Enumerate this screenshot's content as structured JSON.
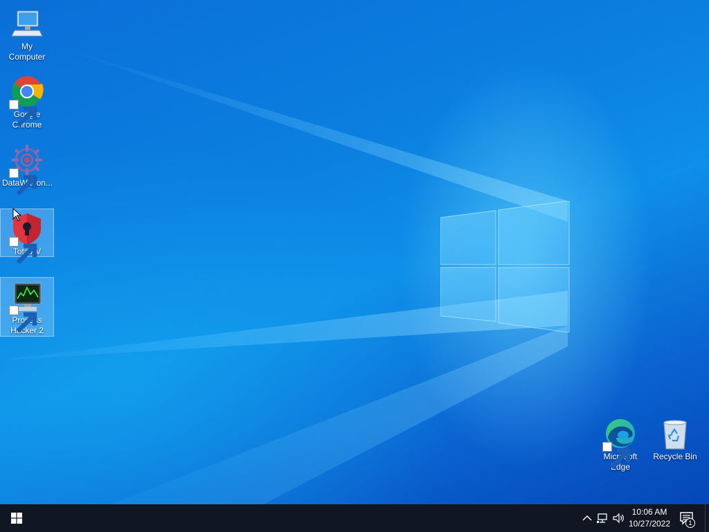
{
  "desktop": {
    "icons": [
      {
        "label": "My Computer",
        "icon": "computer-icon"
      },
      {
        "label": "Google Chrome",
        "icon": "chrome-icon"
      },
      {
        "label": "DataWagon...",
        "icon": "datawagon-icon"
      },
      {
        "label": "TotalAV",
        "icon": "totalav-icon"
      },
      {
        "label": "Process Hacker 2",
        "icon": "process-hacker-icon"
      },
      {
        "label": "Microsoft Edge",
        "icon": "edge-icon"
      },
      {
        "label": "Recycle Bin",
        "icon": "recycle-bin-icon"
      }
    ]
  },
  "taskbar": {
    "time": "10:06 AM",
    "date": "10/27/2022",
    "notification_count": "1"
  },
  "colors": {
    "taskbar": "#101622",
    "wallpaper_accent": "#0a6fd8"
  }
}
